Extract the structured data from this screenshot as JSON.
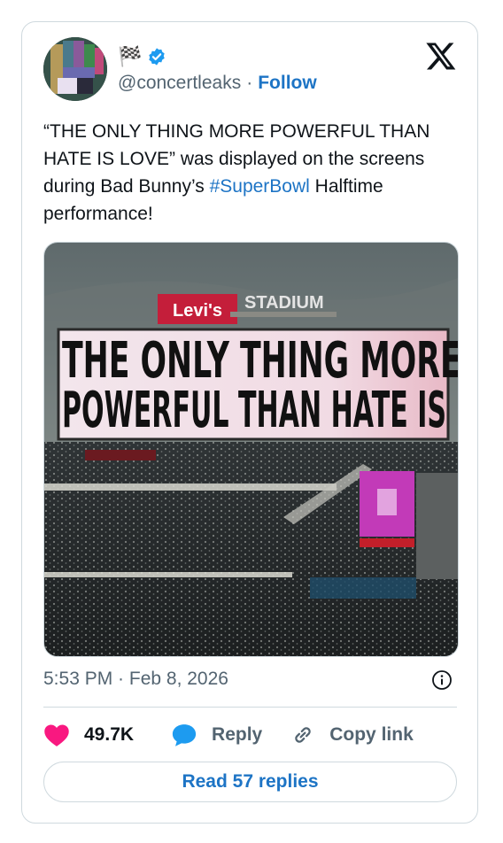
{
  "header": {
    "display_name_emoji": "🏁",
    "handle": "@concertleaks",
    "separator": "·",
    "follow_label": "Follow"
  },
  "tweet": {
    "text_before": "“THE ONLY THING MORE POWERFUL THAN HATE IS LOVE” was displayed on the screens during Bad Bunny’s ",
    "hashtag": "#SuperBowl",
    "text_after": " Halftime performance!"
  },
  "image": {
    "sign_brand": "Levi's",
    "sign_word": "STADIUM",
    "board_line1": "THE ONLY THING MORE",
    "board_line2": "POWERFUL THAN HATE IS LOVE"
  },
  "timestamp": "5:53 PM · Feb 8, 2026",
  "actions": {
    "likes_count": "49.7K",
    "reply_label": "Reply",
    "copy_label": "Copy link"
  },
  "read_replies_label": "Read 57 replies",
  "colors": {
    "accent": "#1d74c5",
    "like": "#f91880",
    "verified": "#1d9bf0"
  }
}
